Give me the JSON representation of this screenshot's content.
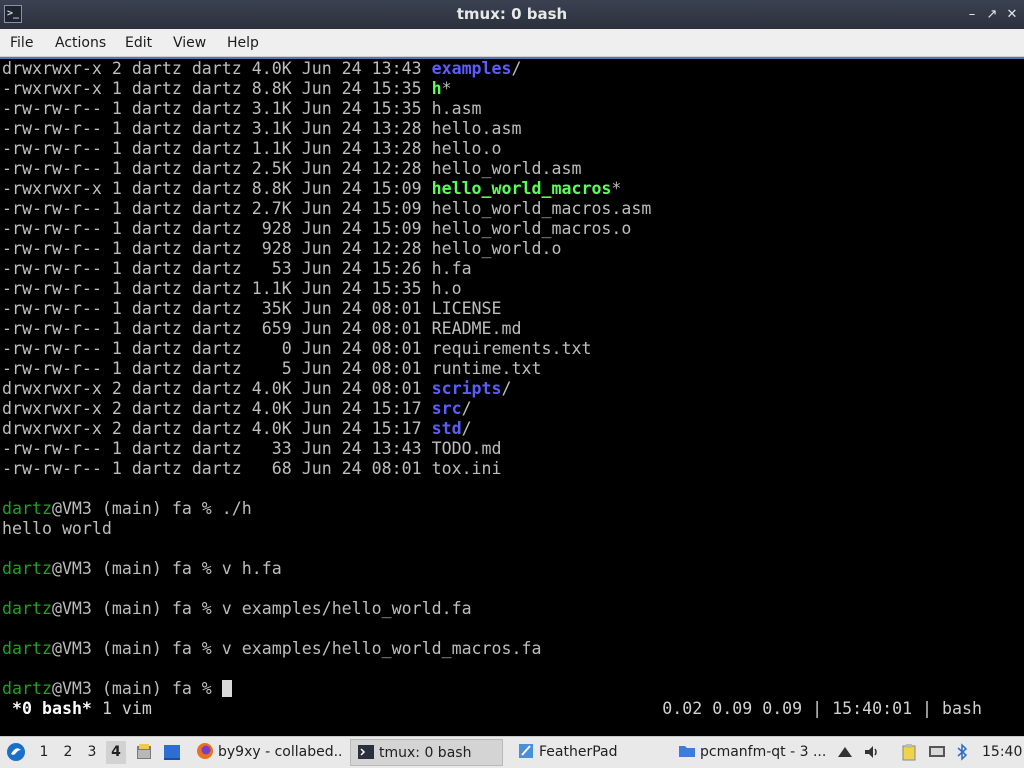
{
  "window": {
    "title": "tmux: 0 bash",
    "app_icon_glyph": ">_",
    "minimize_glyph": "–",
    "maximize_glyph": "↗",
    "close_glyph": "✕"
  },
  "menu": {
    "items": [
      "File",
      "Actions",
      "Edit",
      "View",
      "Help"
    ]
  },
  "terminal": {
    "lines": [
      {
        "perm": "drwxrwxr-x",
        "links": "2",
        "user": "dartz",
        "group": "dartz",
        "size": "4.0K",
        "month": "Jun",
        "day": "24",
        "time": "13:43",
        "name": "examples",
        "kind": "dir",
        "suffix": "/"
      },
      {
        "perm": "-rwxrwxr-x",
        "links": "1",
        "user": "dartz",
        "group": "dartz",
        "size": "8.8K",
        "month": "Jun",
        "day": "24",
        "time": "15:35",
        "name": "h",
        "kind": "exe",
        "suffix": "*"
      },
      {
        "perm": "-rw-rw-r--",
        "links": "1",
        "user": "dartz",
        "group": "dartz",
        "size": "3.1K",
        "month": "Jun",
        "day": "24",
        "time": "15:35",
        "name": "h.asm",
        "kind": "file",
        "suffix": ""
      },
      {
        "perm": "-rw-rw-r--",
        "links": "1",
        "user": "dartz",
        "group": "dartz",
        "size": "3.1K",
        "month": "Jun",
        "day": "24",
        "time": "13:28",
        "name": "hello.asm",
        "kind": "file",
        "suffix": ""
      },
      {
        "perm": "-rw-rw-r--",
        "links": "1",
        "user": "dartz",
        "group": "dartz",
        "size": "1.1K",
        "month": "Jun",
        "day": "24",
        "time": "13:28",
        "name": "hello.o",
        "kind": "file",
        "suffix": ""
      },
      {
        "perm": "-rw-rw-r--",
        "links": "1",
        "user": "dartz",
        "group": "dartz",
        "size": "2.5K",
        "month": "Jun",
        "day": "24",
        "time": "12:28",
        "name": "hello_world.asm",
        "kind": "file",
        "suffix": ""
      },
      {
        "perm": "-rwxrwxr-x",
        "links": "1",
        "user": "dartz",
        "group": "dartz",
        "size": "8.8K",
        "month": "Jun",
        "day": "24",
        "time": "15:09",
        "name": "hello_world_macros",
        "kind": "exe",
        "suffix": "*"
      },
      {
        "perm": "-rw-rw-r--",
        "links": "1",
        "user": "dartz",
        "group": "dartz",
        "size": "2.7K",
        "month": "Jun",
        "day": "24",
        "time": "15:09",
        "name": "hello_world_macros.asm",
        "kind": "file",
        "suffix": ""
      },
      {
        "perm": "-rw-rw-r--",
        "links": "1",
        "user": "dartz",
        "group": "dartz",
        "size": "928",
        "month": "Jun",
        "day": "24",
        "time": "15:09",
        "name": "hello_world_macros.o",
        "kind": "file",
        "suffix": ""
      },
      {
        "perm": "-rw-rw-r--",
        "links": "1",
        "user": "dartz",
        "group": "dartz",
        "size": "928",
        "month": "Jun",
        "day": "24",
        "time": "12:28",
        "name": "hello_world.o",
        "kind": "file",
        "suffix": ""
      },
      {
        "perm": "-rw-rw-r--",
        "links": "1",
        "user": "dartz",
        "group": "dartz",
        "size": "53",
        "month": "Jun",
        "day": "24",
        "time": "15:26",
        "name": "h.fa",
        "kind": "file",
        "suffix": ""
      },
      {
        "perm": "-rw-rw-r--",
        "links": "1",
        "user": "dartz",
        "group": "dartz",
        "size": "1.1K",
        "month": "Jun",
        "day": "24",
        "time": "15:35",
        "name": "h.o",
        "kind": "file",
        "suffix": ""
      },
      {
        "perm": "-rw-rw-r--",
        "links": "1",
        "user": "dartz",
        "group": "dartz",
        "size": "35K",
        "month": "Jun",
        "day": "24",
        "time": "08:01",
        "name": "LICENSE",
        "kind": "file",
        "suffix": ""
      },
      {
        "perm": "-rw-rw-r--",
        "links": "1",
        "user": "dartz",
        "group": "dartz",
        "size": "659",
        "month": "Jun",
        "day": "24",
        "time": "08:01",
        "name": "README.md",
        "kind": "file",
        "suffix": ""
      },
      {
        "perm": "-rw-rw-r--",
        "links": "1",
        "user": "dartz",
        "group": "dartz",
        "size": "0",
        "month": "Jun",
        "day": "24",
        "time": "08:01",
        "name": "requirements.txt",
        "kind": "file",
        "suffix": ""
      },
      {
        "perm": "-rw-rw-r--",
        "links": "1",
        "user": "dartz",
        "group": "dartz",
        "size": "5",
        "month": "Jun",
        "day": "24",
        "time": "08:01",
        "name": "runtime.txt",
        "kind": "file",
        "suffix": ""
      },
      {
        "perm": "drwxrwxr-x",
        "links": "2",
        "user": "dartz",
        "group": "dartz",
        "size": "4.0K",
        "month": "Jun",
        "day": "24",
        "time": "08:01",
        "name": "scripts",
        "kind": "dir",
        "suffix": "/"
      },
      {
        "perm": "drwxrwxr-x",
        "links": "2",
        "user": "dartz",
        "group": "dartz",
        "size": "4.0K",
        "month": "Jun",
        "day": "24",
        "time": "15:17",
        "name": "src",
        "kind": "dir",
        "suffix": "/"
      },
      {
        "perm": "drwxrwxr-x",
        "links": "2",
        "user": "dartz",
        "group": "dartz",
        "size": "4.0K",
        "month": "Jun",
        "day": "24",
        "time": "15:17",
        "name": "std",
        "kind": "dir",
        "suffix": "/"
      },
      {
        "perm": "-rw-rw-r--",
        "links": "1",
        "user": "dartz",
        "group": "dartz",
        "size": "33",
        "month": "Jun",
        "day": "24",
        "time": "13:43",
        "name": "TODO.md",
        "kind": "file",
        "suffix": ""
      },
      {
        "perm": "-rw-rw-r--",
        "links": "1",
        "user": "dartz",
        "group": "dartz",
        "size": "68",
        "month": "Jun",
        "day": "24",
        "time": "08:01",
        "name": "tox.ini",
        "kind": "file",
        "suffix": ""
      },
      {
        "kind": "blank"
      },
      {
        "kind": "prompt",
        "user": "dartz",
        "rest": "@VM3 (main) fa % ",
        "cmd": "./h"
      },
      {
        "kind": "output",
        "text": "hello world"
      },
      {
        "kind": "blank"
      },
      {
        "kind": "prompt",
        "user": "dartz",
        "rest": "@VM3 (main) fa % ",
        "cmd": "v h.fa"
      },
      {
        "kind": "blank"
      },
      {
        "kind": "prompt",
        "user": "dartz",
        "rest": "@VM3 (main) fa % ",
        "cmd": "v examples/hello_world.fa"
      },
      {
        "kind": "blank"
      },
      {
        "kind": "prompt",
        "user": "dartz",
        "rest": "@VM3 (main) fa % ",
        "cmd": "v examples/hello_world_macros.fa"
      },
      {
        "kind": "blank"
      },
      {
        "kind": "prompt",
        "user": "dartz",
        "rest": "@VM3 (main) fa % ",
        "cmd": "",
        "cursor": true
      }
    ],
    "status": {
      "active_window": "*0 bash*",
      "other_window": "1 vim",
      "right": "0.02 0.09 0.09 | 15:40:01 | bash"
    }
  },
  "taskbar": {
    "workspaces": [
      "1",
      "2",
      "3",
      "4"
    ],
    "active_workspace": "4",
    "tasks": [
      {
        "label": "by9xy - collabed...",
        "icon": "firefox-icon"
      },
      {
        "label": "tmux: 0 bash",
        "icon": "terminal-icon",
        "active": true
      },
      {
        "label": "FeatherPad",
        "icon": "featherpad-icon"
      },
      {
        "label": "pcmanfm-qt - 3 ...",
        "icon": "folder-icon"
      }
    ],
    "clock": "15:40",
    "colors": {
      "start_blue": "#1a6fc9",
      "firefox_orange": "#e8731e",
      "folder_blue": "#3b7dd8"
    }
  }
}
